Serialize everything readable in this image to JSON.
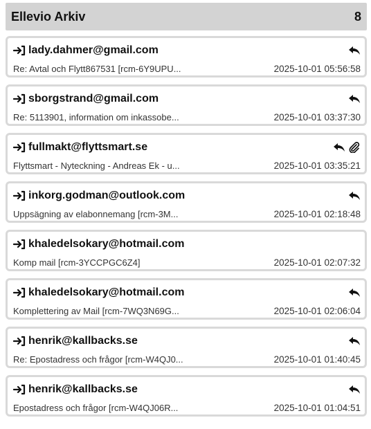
{
  "header": {
    "title": "Ellevio Arkiv",
    "count": "8"
  },
  "messages": [
    {
      "from": "lady.dahmer@gmail.com",
      "subject": "Re: Avtal och Flytt867531 [rcm-6Y9UPU...",
      "date": "2025-10-01 05:56:58",
      "icons": [
        "reply-icon"
      ]
    },
    {
      "from": "sborgstrand@gmail.com",
      "subject": "Re: 5113901, information om inkassobe...",
      "date": "2025-10-01 03:37:30",
      "icons": [
        "reply-icon"
      ]
    },
    {
      "from": "fullmakt@flyttsmart.se",
      "subject": "Flyttsmart - Nyteckning - Andreas Ek - u...",
      "date": "2025-10-01 03:35:21",
      "icons": [
        "reply-icon",
        "attachment-icon"
      ]
    },
    {
      "from": "inkorg.godman@outlook.com",
      "subject": "Uppsägning av elabonnemang [rcm-3M...",
      "date": "2025-10-01 02:18:48",
      "icons": [
        "reply-icon"
      ]
    },
    {
      "from": "khaledelsokary@hotmail.com",
      "subject": "Komp mail [rcm-3YCCPGC6Z4]",
      "date": "2025-10-01 02:07:32",
      "icons": []
    },
    {
      "from": "khaledelsokary@hotmail.com",
      "subject": "Komplettering av Mail [rcm-7WQ3N69G...",
      "date": "2025-10-01 02:06:04",
      "icons": [
        "reply-icon"
      ]
    },
    {
      "from": "henrik@kallbacks.se",
      "subject": "Re: Epostadress och frågor [rcm-W4QJ0...",
      "date": "2025-10-01 01:40:45",
      "icons": [
        "reply-icon"
      ]
    },
    {
      "from": "henrik@kallbacks.se",
      "subject": "Epostadress och frågor [rcm-W4QJ06R...",
      "date": "2025-10-01 01:04:51",
      "icons": [
        "reply-icon"
      ]
    }
  ]
}
